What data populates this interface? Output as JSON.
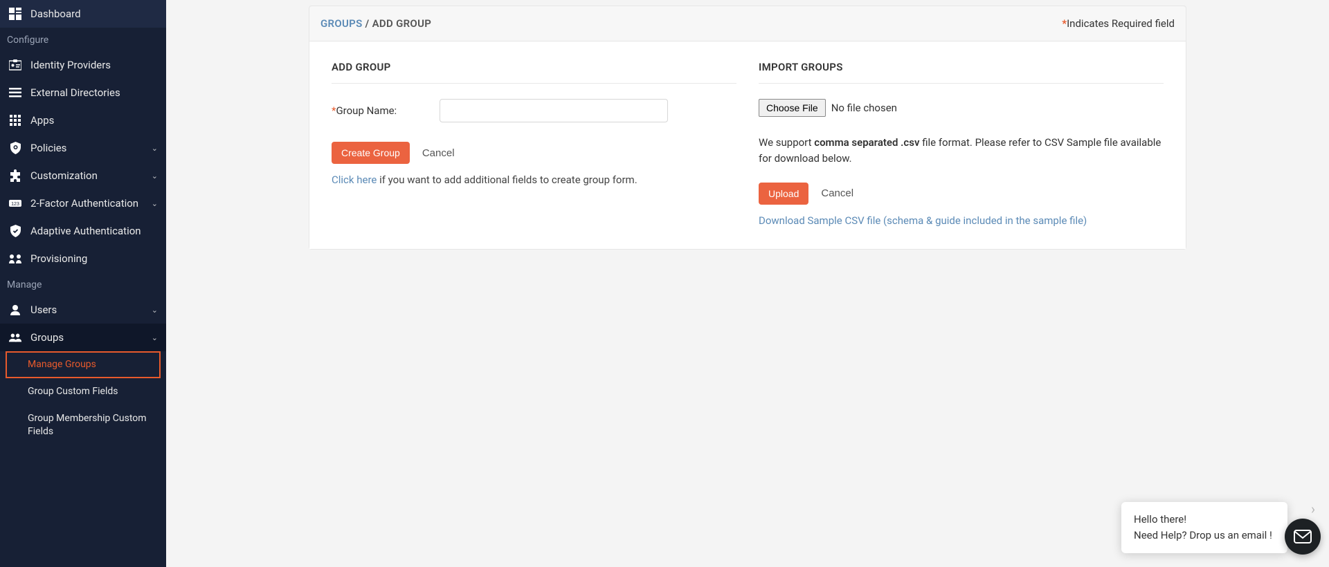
{
  "sidebar": {
    "dashboard": "Dashboard",
    "configure_header": "Configure",
    "identity_providers": "Identity Providers",
    "external_directories": "External Directories",
    "apps": "Apps",
    "policies": "Policies",
    "customization": "Customization",
    "two_factor": "2-Factor Authentication",
    "adaptive_auth": "Adaptive Authentication",
    "provisioning": "Provisioning",
    "manage_header": "Manage",
    "users": "Users",
    "groups": "Groups",
    "sub": {
      "manage_groups": "Manage Groups",
      "group_custom_fields": "Group Custom Fields",
      "group_membership_custom_fields": "Group Membership Custom Fields"
    }
  },
  "breadcrumb": {
    "groups": "GROUPS",
    "sep": " / ",
    "add_group": "ADD GROUP"
  },
  "required_indicator": "Indicates Required field",
  "left_panel": {
    "title": "ADD GROUP",
    "group_name_label": "Group Name:",
    "create_btn": "Create Group",
    "cancel_btn": "Cancel",
    "help_link": "Click here",
    "help_text": " if you want to add additional fields to create group form."
  },
  "right_panel": {
    "title": "IMPORT GROUPS",
    "choose_file_btn": "Choose File",
    "no_file": "No file chosen",
    "info_prefix": "We support ",
    "info_bold": "comma separated .csv",
    "info_suffix": " file format. Please refer to CSV Sample file available for download below.",
    "upload_btn": "Upload",
    "cancel_btn": "Cancel",
    "download_link": "Download Sample CSV file (schema & guide included in the sample file)"
  },
  "chat": {
    "greeting": "Hello there!",
    "help": "Need Help? Drop us an email !"
  },
  "colors": {
    "sidebar_bg": "#172035",
    "accent": "#eb6340",
    "link": "#5b8ab6"
  }
}
